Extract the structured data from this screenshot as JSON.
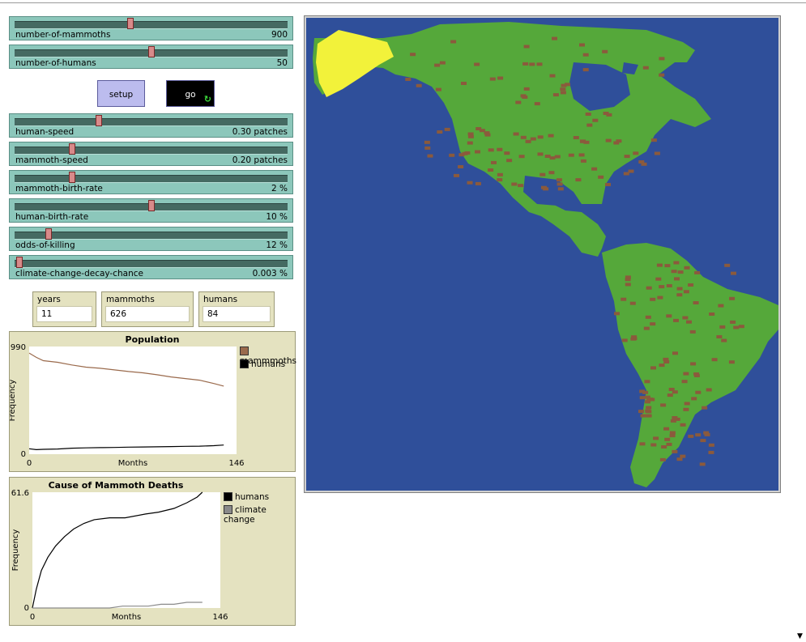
{
  "sliders": [
    {
      "label": "number-of-mammoths",
      "value": "900",
      "fraction": 0.42
    },
    {
      "label": "number-of-humans",
      "value": "50",
      "fraction": 0.5
    },
    {
      "label": "human-speed",
      "value": "0.30 patches",
      "fraction": 0.3
    },
    {
      "label": "mammoth-speed",
      "value": "0.20 patches",
      "fraction": 0.2
    },
    {
      "label": "mammoth-birth-rate",
      "value": "2 %",
      "fraction": 0.2
    },
    {
      "label": "human-birth-rate",
      "value": "10 %",
      "fraction": 0.5
    },
    {
      "label": "odds-of-killing",
      "value": "12 %",
      "fraction": 0.11
    },
    {
      "label": "climate-change-decay-chance",
      "value": "0.003 %",
      "fraction": 0.0
    }
  ],
  "buttons": {
    "setup": "setup",
    "go": "go"
  },
  "monitors": [
    {
      "label": "years",
      "value": "11"
    },
    {
      "label": "mammoths",
      "value": "626"
    },
    {
      "label": "humans",
      "value": "84"
    }
  ],
  "colors": {
    "slider_bg": "#8cc7bb",
    "monitor_bg": "#e4e2c0",
    "ocean": "#2f4f9a",
    "land": "#55a83a",
    "mammoth": "#8b5a3c",
    "human": "#f2f23a",
    "mammoth_line": "#9a6a4c",
    "climate_line": "#8a8a8a"
  },
  "chart_data": [
    {
      "type": "line",
      "title": "Population",
      "xlabel": "Months",
      "ylabel": "Frequency",
      "xlim": [
        0,
        146
      ],
      "ylim": [
        0,
        990
      ],
      "series": [
        {
          "name": "mammmoths",
          "x": [
            0,
            5,
            10,
            20,
            30,
            40,
            50,
            60,
            70,
            80,
            90,
            100,
            110,
            120,
            130,
            137
          ],
          "values": [
            930,
            890,
            860,
            845,
            820,
            800,
            790,
            775,
            760,
            748,
            730,
            710,
            695,
            680,
            650,
            626
          ]
        },
        {
          "name": "humans",
          "x": [
            0,
            5,
            10,
            20,
            30,
            40,
            50,
            60,
            70,
            80,
            90,
            100,
            110,
            120,
            130,
            137
          ],
          "values": [
            50,
            42,
            45,
            48,
            55,
            58,
            60,
            62,
            65,
            66,
            68,
            70,
            72,
            74,
            78,
            84
          ]
        }
      ]
    },
    {
      "type": "line",
      "title": "Cause of Mammoth Deaths",
      "xlabel": "Months",
      "ylabel": "Frequency",
      "xlim": [
        0,
        146
      ],
      "ylim": [
        0,
        61.6
      ],
      "series": [
        {
          "name": "humans",
          "x": [
            0,
            3,
            7,
            12,
            18,
            25,
            32,
            40,
            48,
            60,
            72,
            88,
            98,
            110,
            120,
            128,
            132
          ],
          "values": [
            0,
            10,
            20,
            27,
            33,
            38,
            42,
            45,
            47,
            48,
            48,
            50,
            51,
            53,
            56,
            59,
            61.6
          ]
        },
        {
          "name": "climate change",
          "x": [
            0,
            60,
            70,
            80,
            90,
            100,
            110,
            120,
            128,
            132
          ],
          "values": [
            0,
            0,
            1,
            1,
            1,
            2,
            2,
            3,
            3,
            3
          ]
        }
      ]
    }
  ],
  "world": {
    "description_label": ""
  }
}
